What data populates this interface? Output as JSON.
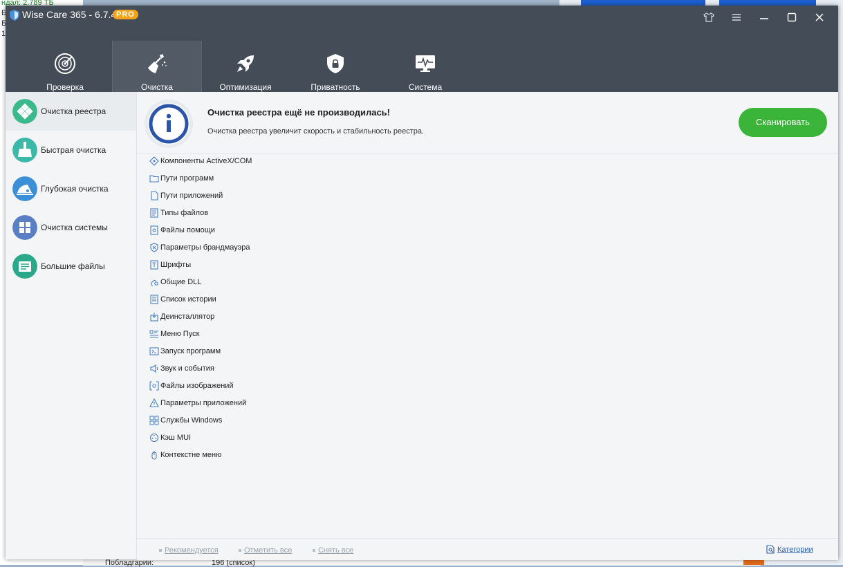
{
  "background": {
    "left_lines": [
      "ндал: 2.789 ТБ",
      "Б",
      "Б",
      "13"
    ],
    "bottom_left_label": "Побладгарии:",
    "bottom_value": "196   (список)"
  },
  "app": {
    "title": "Wise Care 365 - 6.7.4",
    "badge": "PRO"
  },
  "nav": {
    "tabs": [
      {
        "label": "Проверка"
      },
      {
        "label": "Очистка"
      },
      {
        "label": "Оптимизация"
      },
      {
        "label": "Приватность"
      },
      {
        "label": "Система"
      }
    ],
    "active_index": 1
  },
  "sidebar": {
    "items": [
      {
        "label": "Очистка реестра",
        "color": "#3aba8c"
      },
      {
        "label": "Быстрая очистка",
        "color": "#3bb8a8"
      },
      {
        "label": "Глубокая очистка",
        "color": "#3b8fd6"
      },
      {
        "label": "Очистка системы",
        "color": "#5b7fc4"
      },
      {
        "label": "Большие файлы",
        "color": "#2aa88a"
      }
    ]
  },
  "banner": {
    "title": "Очистка реестра ещё не производилась!",
    "description": "Очистка реестра увеличит скорость и стабильность реестра.",
    "scan_button": "Сканировать"
  },
  "categories": [
    {
      "label": "Компоненты ActiveX/COM",
      "icon": "activex-icon"
    },
    {
      "label": "Пути программ",
      "icon": "folder-icon"
    },
    {
      "label": "Пути приложений",
      "icon": "document-icon"
    },
    {
      "label": "Типы файлов",
      "icon": "file-types-icon"
    },
    {
      "label": "Файлы помощи",
      "icon": "help-file-icon"
    },
    {
      "label": "Параметры брандмауэра",
      "icon": "firewall-icon"
    },
    {
      "label": "Шрифты",
      "icon": "font-icon"
    },
    {
      "label": "Общие DLL",
      "icon": "dll-icon"
    },
    {
      "label": "Список истории",
      "icon": "history-icon"
    },
    {
      "label": "Деинсталлятор",
      "icon": "uninstaller-icon"
    },
    {
      "label": "Меню Пуск",
      "icon": "start-menu-icon"
    },
    {
      "label": "Запуск программ",
      "icon": "startup-icon"
    },
    {
      "label": "Звук и события",
      "icon": "sound-icon"
    },
    {
      "label": "Файлы изображений",
      "icon": "image-files-icon"
    },
    {
      "label": "Параметры приложений",
      "icon": "app-settings-icon"
    },
    {
      "label": "Службы Windows",
      "icon": "services-icon"
    },
    {
      "label": "Кэш MUI",
      "icon": "mui-cache-icon"
    },
    {
      "label": "Контекстне меню",
      "icon": "context-menu-icon"
    }
  ],
  "footer": {
    "recommended": "Рекомендуется",
    "select_all": "Отметить все",
    "deselect_all": "Снять все",
    "categories": "Категории"
  },
  "colors": {
    "titlebar": "#444c57",
    "scan_button": "#3ab53a",
    "pro_badge": "#f2a51a",
    "info_badge": "#2a55a8"
  }
}
